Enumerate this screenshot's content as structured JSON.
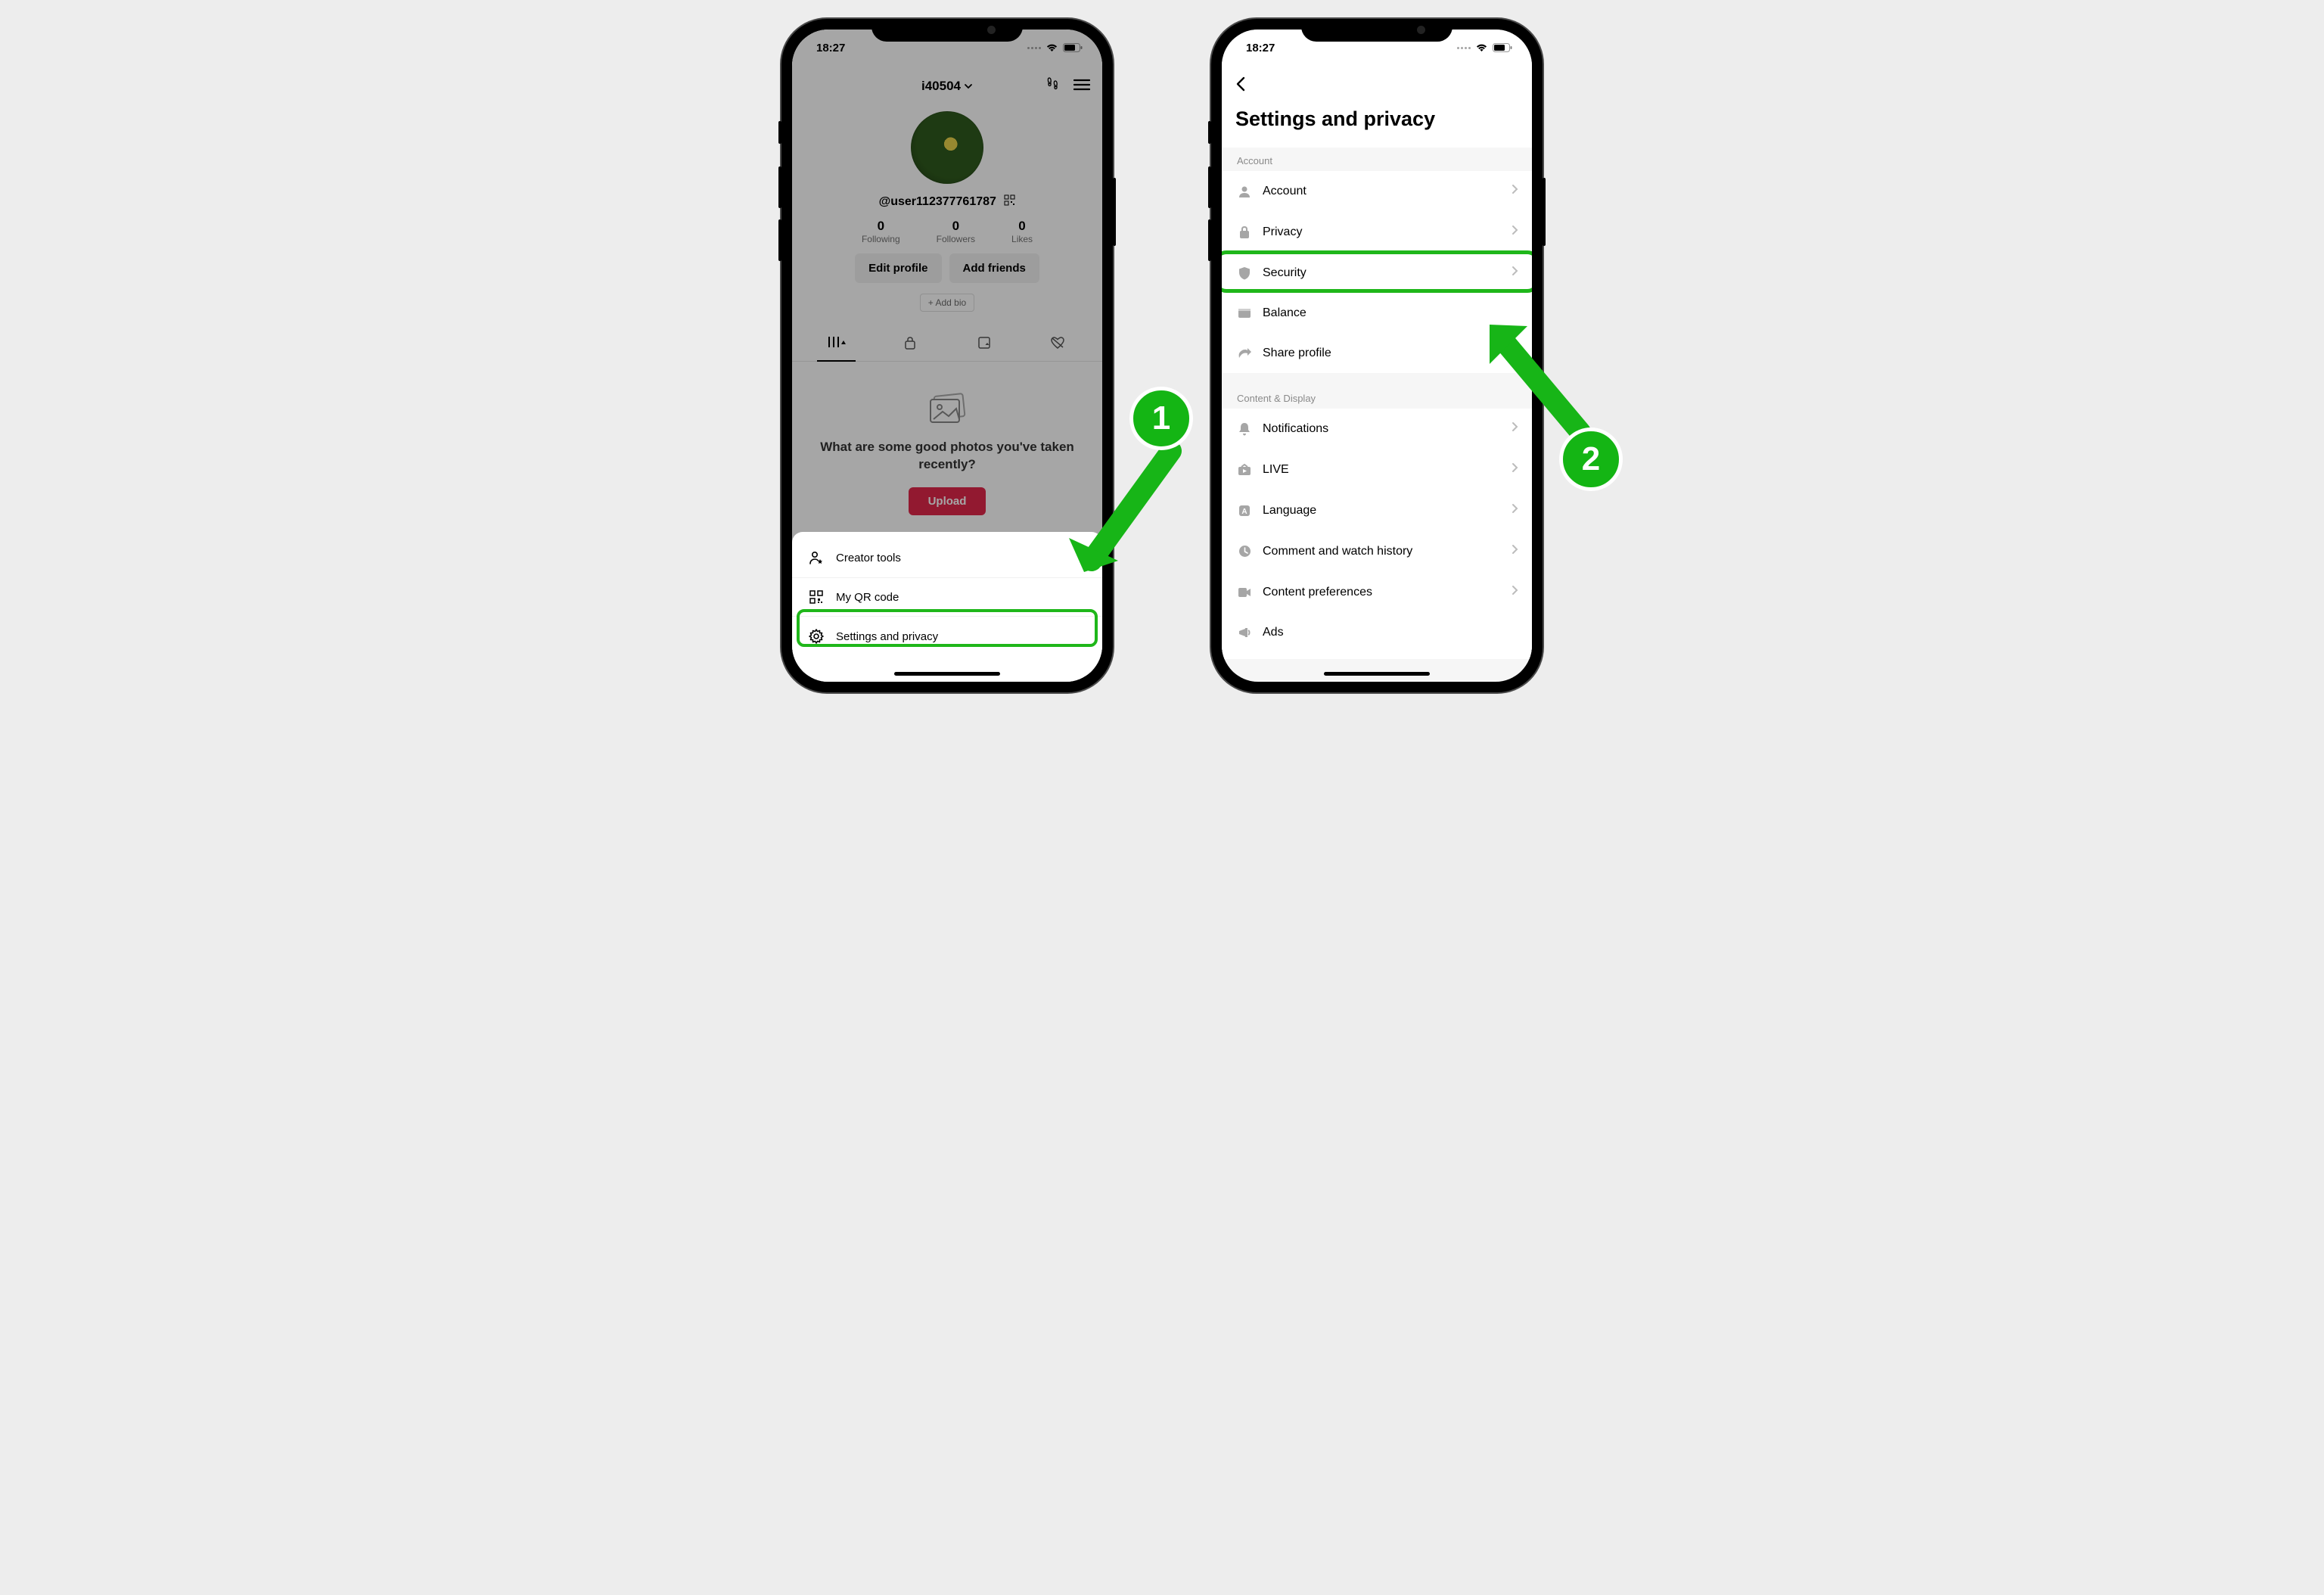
{
  "common": {
    "time": "18:27"
  },
  "phone1": {
    "username_top": "i40504",
    "handle": "@user112377761787",
    "stats": {
      "following": {
        "count": "0",
        "label": "Following"
      },
      "followers": {
        "count": "0",
        "label": "Followers"
      },
      "likes": {
        "count": "0",
        "label": "Likes"
      }
    },
    "buttons": {
      "edit": "Edit profile",
      "addfriends": "Add friends"
    },
    "addbio": "+ Add bio",
    "empty_text": "What are some good photos you've taken recently?",
    "upload": "Upload",
    "sheet": {
      "creator": "Creator tools",
      "qr": "My QR code",
      "settings": "Settings and privacy"
    },
    "badge": "1"
  },
  "phone2": {
    "title": "Settings and privacy",
    "sections": {
      "account": {
        "label": "Account",
        "items": {
          "account": "Account",
          "privacy": "Privacy",
          "security": "Security",
          "balance": "Balance",
          "share": "Share profile"
        }
      },
      "content": {
        "label": "Content & Display",
        "items": {
          "notifications": "Notifications",
          "live": "LIVE",
          "language": "Language",
          "history": "Comment and watch history",
          "prefs": "Content preferences",
          "ads": "Ads"
        }
      }
    },
    "badge": "2"
  }
}
